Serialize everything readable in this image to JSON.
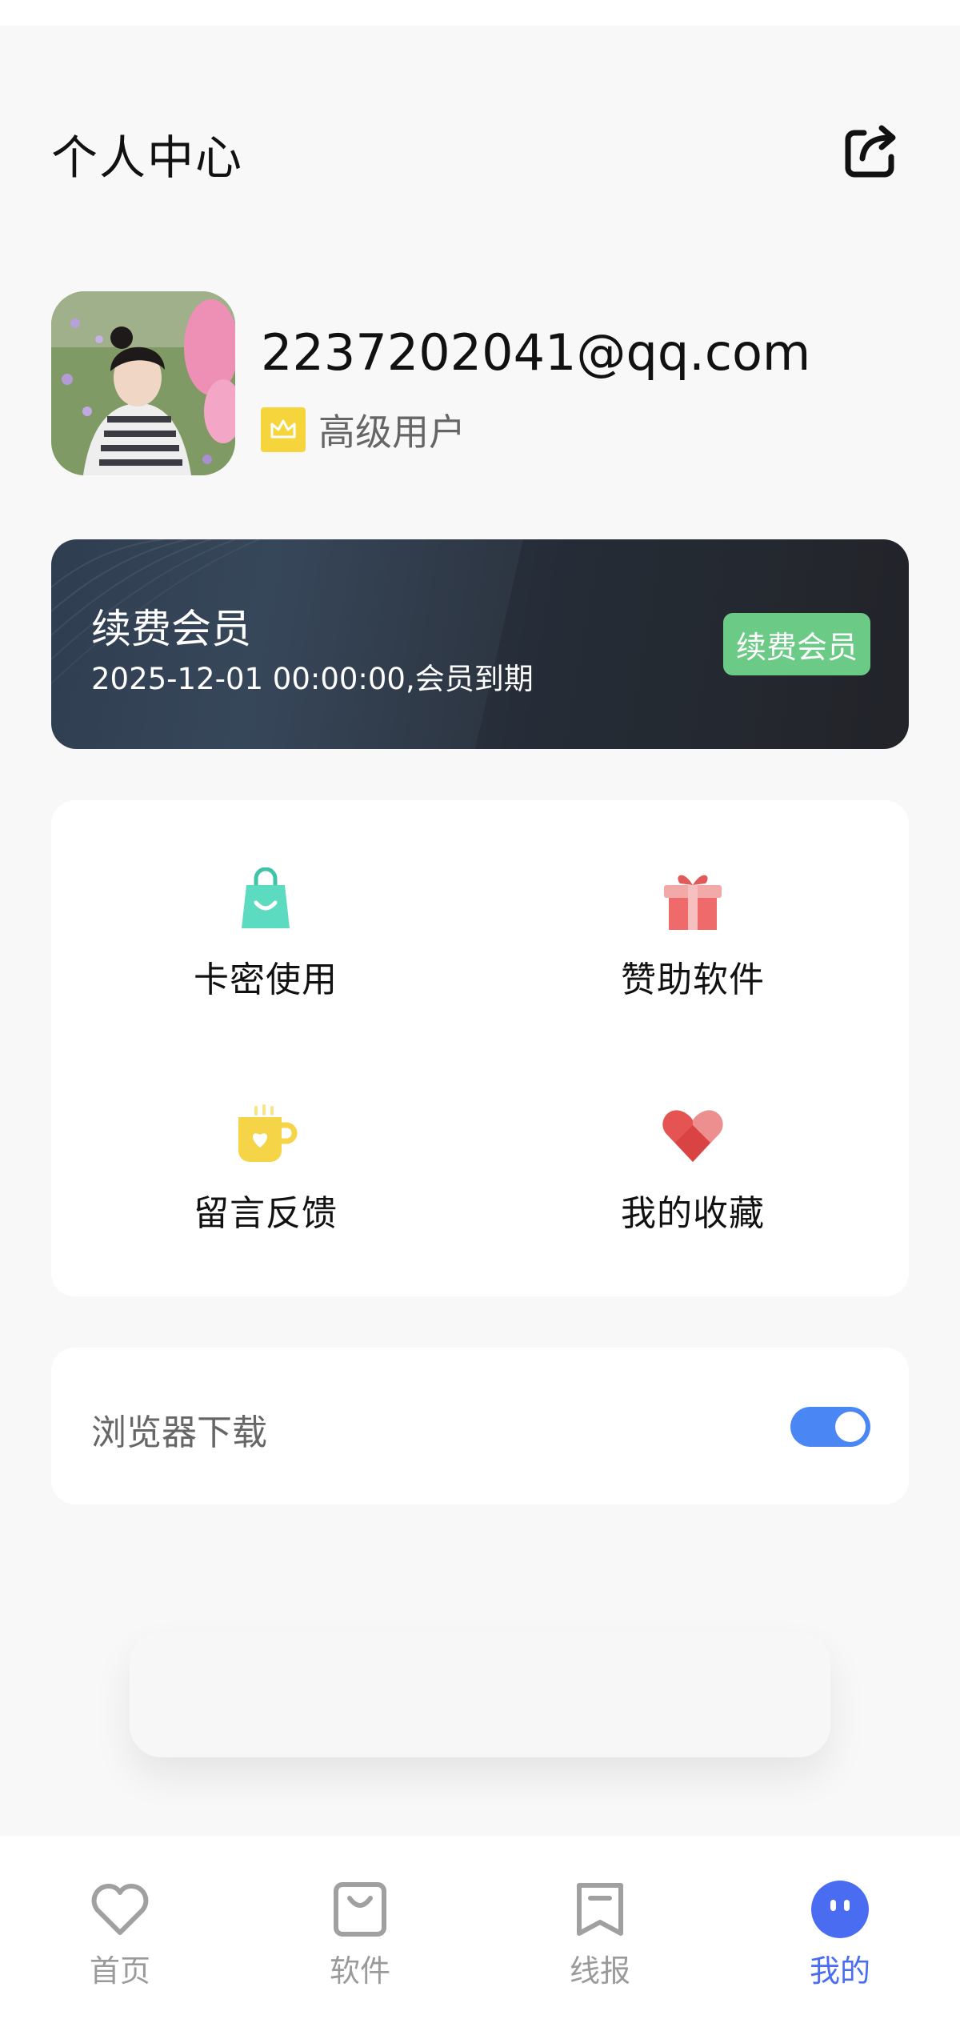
{
  "header": {
    "title": "个人中心"
  },
  "profile": {
    "email": "2237202041@qq.com",
    "level": "高级用户"
  },
  "vip": {
    "title": "续费会员",
    "expire": "2025-12-01 00:00:00,会员到期",
    "button": "续费会员"
  },
  "menu": [
    {
      "label": "卡密使用",
      "icon": "shopping-bag-icon"
    },
    {
      "label": "赞助软件",
      "icon": "gift-icon"
    },
    {
      "label": "留言反馈",
      "icon": "mug-heart-icon"
    },
    {
      "label": "我的收藏",
      "icon": "heart-icon"
    }
  ],
  "settings": {
    "browser_download": {
      "label": "浏览器下载",
      "enabled": true
    }
  },
  "tabs": [
    {
      "label": "首页",
      "icon": "heart-outline-icon",
      "active": false
    },
    {
      "label": "软件",
      "icon": "bag-outline-icon",
      "active": false
    },
    {
      "label": "线报",
      "icon": "bookmark-icon",
      "active": false
    },
    {
      "label": "我的",
      "icon": "face-icon",
      "active": true
    }
  ],
  "colors": {
    "accent": "#4a6cf0",
    "toggle_on": "#4b86f5",
    "vip_button": "#6bcb86",
    "badge": "#f6d53c"
  }
}
